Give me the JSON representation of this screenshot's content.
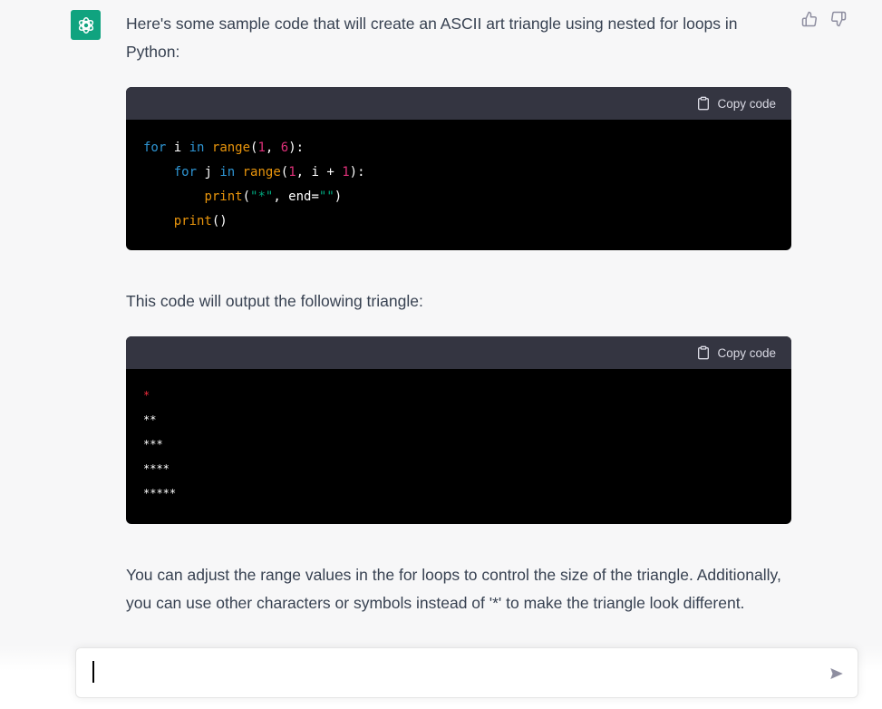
{
  "assistant": {
    "avatar_icon": "openai-logo-icon",
    "feedback": {
      "thumbs_up_icon": "thumbs-up-icon",
      "thumbs_down_icon": "thumbs-down-icon"
    },
    "intro_text": "Here's some sample code that will create an ASCII art triangle using nested for loops in Python:",
    "code_block_1": {
      "copy_label": "Copy code",
      "language": "python",
      "lines": [
        "for i in range(1, 6):",
        "    for j in range(1, i + 1):",
        "        print(\"*\", end=\"\")",
        "    print()"
      ]
    },
    "middle_text": "This code will output the following triangle:",
    "code_block_2": {
      "copy_label": "Copy code",
      "lines": [
        "*",
        "**",
        "***",
        "****",
        "*****"
      ]
    },
    "outro_text": "You can adjust the range values in the for loops to control the size of the triangle. Additionally, you can use other characters or symbols instead of '*' to make the triangle look different."
  },
  "composer": {
    "value": "",
    "send_icon": "send-icon"
  },
  "colors": {
    "brand": "#10a37f",
    "code_bg": "#000000",
    "code_header_bg": "#343541",
    "page_bg": "#f7f7f8"
  }
}
